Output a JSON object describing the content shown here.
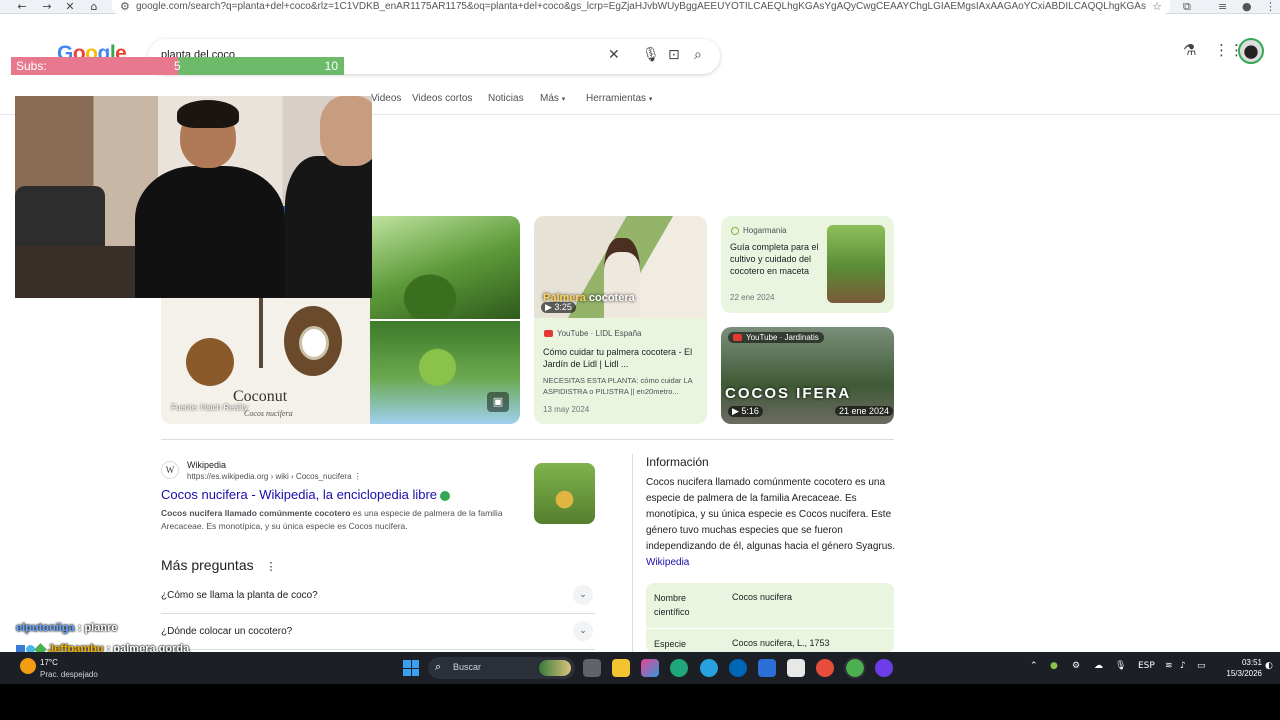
{
  "browser": {
    "url": "google.com/search?q=planta+del+coco&rlz=1C1VDKB_enAR1175AR1175&oq=planta+del+coco&gs_lcrp=EgZjaHJvbWUyBggAEEUYOTILCAEQLhgKGAsYgAQyCwgCEAAYChgLGIAEMgsIAxAAGAoYCxiABDILCAQQLhgKGAsYgAQyCwgFEAAYChgL..."
  },
  "search": {
    "query": "planta del coco"
  },
  "subs_overlay": {
    "label": "Subs:",
    "current": "5",
    "goal": "10",
    "progress": 0.5
  },
  "tabs": [
    "Videos",
    "Videos cortos",
    "Noticias",
    "Más",
    "Herramientas"
  ],
  "images": {
    "coconut_title": "Coconut",
    "coconut_subtitle": "Cocos nucifera",
    "coconut_source": "Fuente: Hatch Reality",
    "card1": {
      "thumb_title_1": "Palmera",
      "thumb_title_2": "cocotera",
      "duration": "3:25",
      "source": "YouTube · LIDL España",
      "title": "Cómo cuidar tu palmera cocotera - El Jardín de Lidl | Lidl ...",
      "desc": "NECESITAS ESTA PLANTA: cómo cuidar LA ASPIDISTRA o PILISTRA || en20metro...",
      "date": "13 may 2024"
    },
    "card2": {
      "source": "Hogarmania",
      "title": "Guía completa para el cultivo y cuidado del cocotero en maceta",
      "date": "22 ene 2024"
    },
    "card3": {
      "source": "YouTube · Jardinatis",
      "title": "COCOS  IFERA",
      "duration": "5:16",
      "date": "21 ene 2024"
    }
  },
  "result": {
    "site_name": "Wikipedia",
    "site_url": "https://es.wikipedia.org › wiki › Cocos_nucifera",
    "title": "Cocos nucifera - Wikipedia, la enciclopedia libre",
    "snippet_bold": "Cocos nucifera llamado comúnmente cocotero",
    "snippet_rest": " es una especie de palmera de la familia Arecaceae. Es monotípica, y su única especie es Cocos nucifera."
  },
  "paa": {
    "title": "Más preguntas",
    "questions": [
      "¿Cómo se llama la planta de coco?",
      "¿Dónde colocar un cocotero?"
    ]
  },
  "knowledge": {
    "title": "Información",
    "text": "Cocos nucifera llamado comúnmente cocotero es una especie de palmera de la familia Arecaceae. Es monotípica, y su única especie es Cocos nucifera. Este género tuvo muchas especies que se fueron independizando de él, algunas hacia el género Syagrus.",
    "link": "Wikipedia",
    "row1_key": "Nombre científico",
    "row1_val": "Cocos nucifera",
    "row2_key": "Especie",
    "row2_val": "Cocos nucifera, L., 1753"
  },
  "chat": [
    {
      "user": "elputoniiga",
      "sep": " : ",
      "msg": "planre"
    },
    {
      "user": "Jeffpambu",
      "sep": " : ",
      "msg": "palmera gorda"
    }
  ],
  "taskbar": {
    "temp": "17°C",
    "condition": "Prac. despejado",
    "search_label": "Buscar",
    "lang": "ESP",
    "time": "03:51",
    "date": "15/3/2026"
  }
}
